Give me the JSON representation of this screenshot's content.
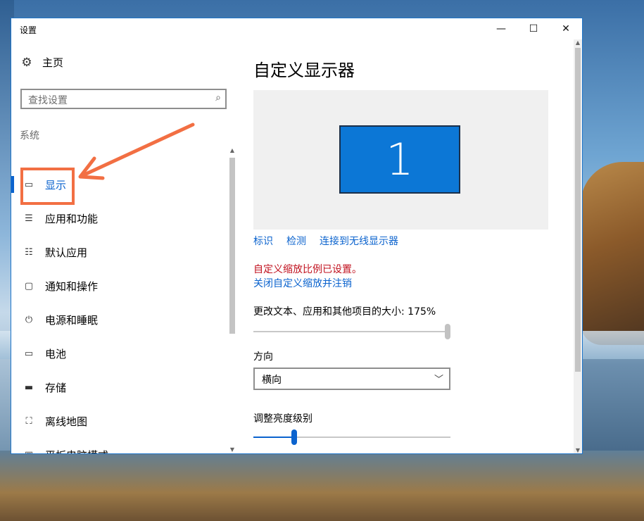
{
  "window": {
    "title": "设置",
    "minimize_glyph": "—",
    "maximize_glyph": "☐",
    "close_glyph": "✕"
  },
  "sidebar": {
    "home": {
      "label": "主页",
      "icon": "gear-icon"
    },
    "search": {
      "placeholder": "查找设置",
      "icon": "search-icon"
    },
    "section_title": "系统",
    "items": [
      {
        "label": "显示",
        "icon": "monitor-icon",
        "active": true
      },
      {
        "label": "应用和功能",
        "icon": "list-icon"
      },
      {
        "label": "默认应用",
        "icon": "list-check-icon"
      },
      {
        "label": "通知和操作",
        "icon": "message-icon"
      },
      {
        "label": "电源和睡眠",
        "icon": "power-icon"
      },
      {
        "label": "电池",
        "icon": "battery-icon"
      },
      {
        "label": "存储",
        "icon": "storage-icon"
      },
      {
        "label": "离线地图",
        "icon": "map-icon"
      },
      {
        "label": "平板电脑模式",
        "icon": "tablet-icon"
      }
    ]
  },
  "content": {
    "title": "自定义显示器",
    "monitor_number": "1",
    "links": [
      "标识",
      "检测",
      "连接到无线显示器"
    ],
    "warning": "自定义缩放比例已设置。",
    "warning_link": "关闭自定义缩放并注销",
    "scale": {
      "label": "更改文本、应用和其他项目的大小: 175%",
      "value_fraction": 1.0
    },
    "orientation": {
      "label": "方向",
      "selected": "横向"
    },
    "brightness": {
      "label": "调整亮度级别",
      "value_fraction": 0.2
    }
  },
  "colors": {
    "accent": "#0b63ce",
    "monitor_fill": "#0c77d6",
    "warning": "#c1121f",
    "annotation": "#f26f43"
  }
}
